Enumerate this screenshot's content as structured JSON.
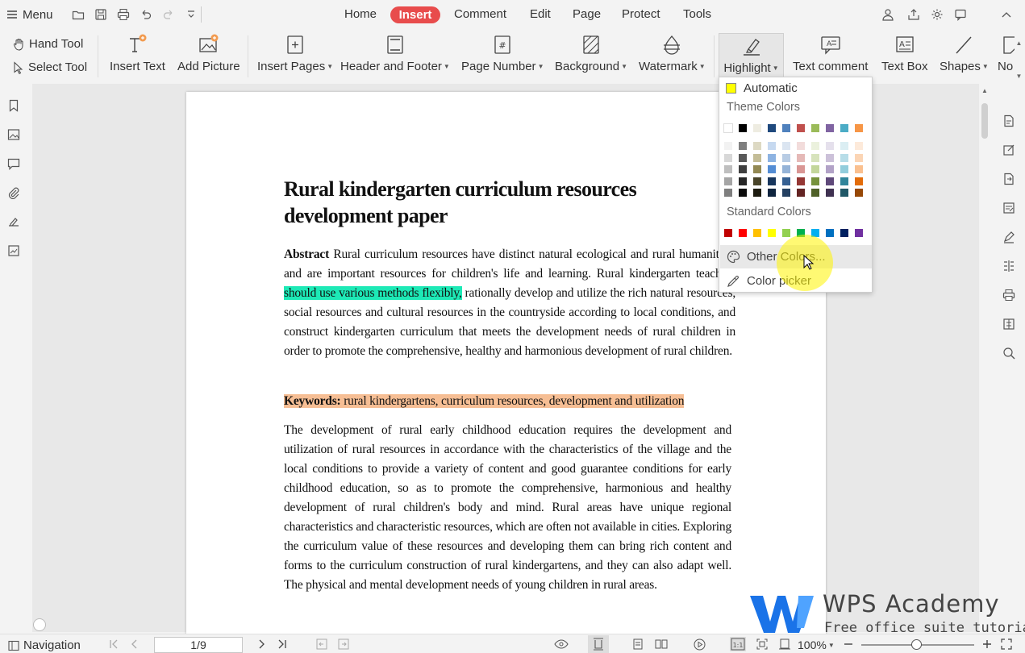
{
  "topbar": {
    "menu_label": "Menu",
    "tabs": [
      "Home",
      "Insert",
      "Comment",
      "Edit",
      "Page",
      "Protect",
      "Tools"
    ],
    "active_tab": "Insert",
    "accent_color": "#e84c4c"
  },
  "ribbon": {
    "hand_tool": "Hand Tool",
    "select_tool": "Select Tool",
    "insert_text": "Insert Text",
    "add_picture": "Add Picture",
    "insert_pages": "Insert Pages",
    "header_footer": "Header and Footer",
    "page_number": "Page Number",
    "background": "Background",
    "watermark": "Watermark",
    "highlight": "Highlight",
    "text_comment": "Text comment",
    "text_box": "Text Box",
    "shapes": "Shapes",
    "note": "No"
  },
  "highlight_menu": {
    "automatic": "Automatic",
    "theme_colors_label": "Theme Colors",
    "standard_colors_label": "Standard Colors",
    "other_colors": "Other Colors...",
    "color_picker": "Color picker",
    "theme_top_row": [
      "#ffffff",
      "#000000",
      "#eeece1",
      "#1f497d",
      "#4f81bd",
      "#c0504d",
      "#9bbb59",
      "#8064a2",
      "#4bacc6",
      "#f79646"
    ],
    "theme_shades": [
      [
        "#f2f2f2",
        "#7f7f7f",
        "#ddd9c3",
        "#c6d9f0",
        "#dbe5f1",
        "#f2dcdb",
        "#ebf1dd",
        "#e5e0ec",
        "#dbeef3",
        "#fdeada"
      ],
      [
        "#d8d8d8",
        "#595959",
        "#c4bd97",
        "#8db3e2",
        "#b8cce4",
        "#e5b9b7",
        "#d7e3bc",
        "#ccc1d9",
        "#b7dde8",
        "#fbd5b5"
      ],
      [
        "#bfbfbf",
        "#3f3f3f",
        "#938953",
        "#548dd4",
        "#95b3d7",
        "#d99694",
        "#c3d69b",
        "#b2a2c7",
        "#92cddc",
        "#fac08f"
      ],
      [
        "#a5a5a5",
        "#262626",
        "#494429",
        "#17365d",
        "#366092",
        "#953734",
        "#76923c",
        "#5f497a",
        "#31859b",
        "#e36c09"
      ],
      [
        "#7f7f7f",
        "#0c0c0c",
        "#1d1b10",
        "#0f243e",
        "#244061",
        "#632423",
        "#4f6128",
        "#3f3151",
        "#205867",
        "#974806"
      ]
    ],
    "standard_colors": [
      "#c00000",
      "#ff0000",
      "#ffc000",
      "#ffff00",
      "#92d050",
      "#00b050",
      "#00b0f0",
      "#0070c0",
      "#002060",
      "#7030a0"
    ]
  },
  "document": {
    "title": "Rural kindergarten curriculum resources development paper",
    "abstract_label": "Abstract",
    "abstract_pre": " Rural curriculum resources have distinct natural ecological and rural humanities, and are important resources for children's life and learning. Rural kindergarten teachers ",
    "abstract_highlight": "should use various methods flexibly,",
    "abstract_post": " rationally develop and utilize the rich natural resources, social resources and cultural resources in the countryside according to local conditions, and construct kindergarten curriculum that meets the development needs of rural children in order to promote the comprehensive, healthy and harmonious development of rural children.",
    "keywords_label": "Keywords:",
    "keywords_text": " rural kindergartens, curriculum resources, development and utilization",
    "body": "The development of rural early childhood education requires the development and utilization of rural resources in accordance with the characteristics of the village and the local conditions to provide a variety of content and good guarantee conditions for early childhood education, so as to promote the comprehensive, harmonious and healthy development of rural children's body and mind. Rural areas have unique regional characteristics and characteristic resources, which are often not available in cities. Exploring the curriculum value of these resources and developing them can bring rich content and forms to the curriculum construction of rural kindergartens, and they can also adapt well. The physical and mental development needs of young children in rural areas."
  },
  "statusbar": {
    "navigation": "Navigation",
    "page_indicator": "1/9",
    "zoom": "100%"
  },
  "watermark": {
    "title": "WPS Academy",
    "subtitle": "Free office suite tutorials"
  }
}
